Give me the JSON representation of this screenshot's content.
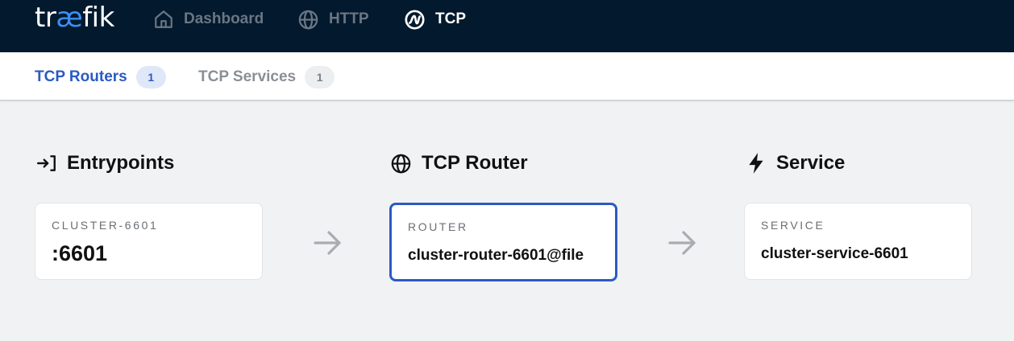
{
  "logo": {
    "prefix": "tr",
    "highlight": "æ",
    "suffix": "fik"
  },
  "nav": [
    {
      "label": "Dashboard",
      "icon": "home-icon",
      "active": false
    },
    {
      "label": "HTTP",
      "icon": "globe-icon",
      "active": false
    },
    {
      "label": "TCP",
      "icon": "tcp-icon",
      "active": true
    }
  ],
  "subnav": [
    {
      "label": "TCP Routers",
      "count": "1",
      "active": true
    },
    {
      "label": "TCP Services",
      "count": "1",
      "active": false
    }
  ],
  "sections": {
    "entrypoints": {
      "title": "Entrypoints",
      "icon": "entrypoint-icon",
      "card_label": "CLUSTER-6601",
      "card_value": ":6601"
    },
    "router": {
      "title": "TCP Router",
      "icon": "globe-icon",
      "card_label": "ROUTER",
      "card_value": "cluster-router-6601@file"
    },
    "service": {
      "title": "Service",
      "icon": "bolt-icon",
      "card_label": "SERVICE",
      "card_value": "cluster-service-6601"
    }
  },
  "colors": {
    "topbar": "#03192d",
    "accent": "#2a5bc2",
    "logo_accent": "#3b8ff5",
    "background": "#f1f2f4"
  }
}
